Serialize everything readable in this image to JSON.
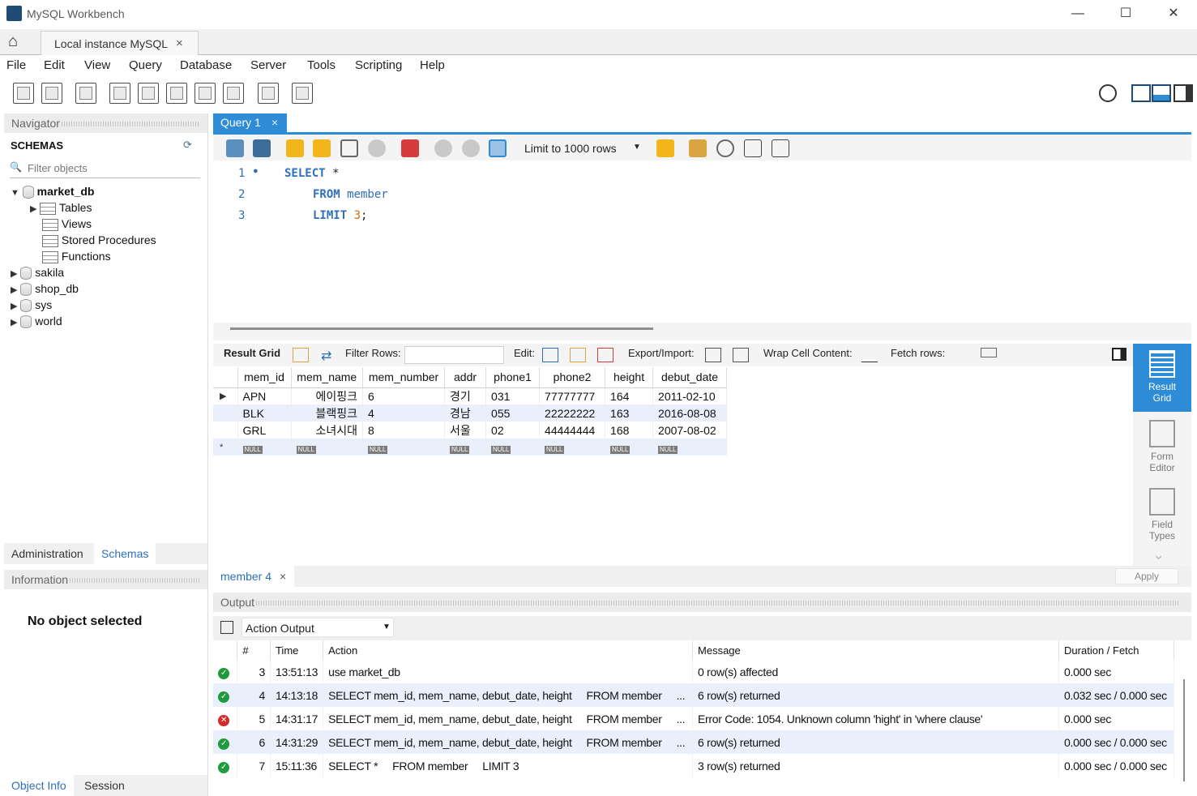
{
  "window": {
    "title": "MySQL Workbench",
    "minimize": "—",
    "maximize": "☐",
    "close": "✕"
  },
  "connection_tab": {
    "label": "Local instance MySQL",
    "close": "×"
  },
  "menu": [
    "File",
    "Edit",
    "View",
    "Query",
    "Database",
    "Server",
    "Tools",
    "Scripting",
    "Help"
  ],
  "navigator": {
    "header": "Navigator",
    "schemas_title": "SCHEMAS",
    "filter_placeholder": "Filter objects",
    "schemas": [
      {
        "name": "market_db",
        "expanded": true,
        "children": [
          "Tables",
          "Views",
          "Stored Procedures",
          "Functions"
        ]
      },
      {
        "name": "sakila"
      },
      {
        "name": "shop_db"
      },
      {
        "name": "sys"
      },
      {
        "name": "world"
      }
    ],
    "tabs": [
      "Administration",
      "Schemas"
    ],
    "active_tab": "Schemas"
  },
  "information": {
    "header": "Information",
    "message": "No object selected",
    "tabs": [
      "Object Info",
      "Session"
    ]
  },
  "query_tab": {
    "label": "Query 1",
    "close": "×"
  },
  "query_toolbar": {
    "limit_label": "Limit to 1000 rows"
  },
  "editor": {
    "lines": [
      {
        "n": "1",
        "dot": "●",
        "kw": "SELECT",
        "rest": " *"
      },
      {
        "n": "2",
        "kw": "FROM",
        "rest": " member"
      },
      {
        "n": "3",
        "kw": "LIMIT",
        "num": "3",
        "rest": ";"
      }
    ]
  },
  "result_toolbar": {
    "result_grid": "Result Grid",
    "filter_rows": "Filter Rows:",
    "edit": "Edit:",
    "export_import": "Export/Import:",
    "wrap": "Wrap Cell Content:",
    "fetch": "Fetch rows:"
  },
  "grid": {
    "columns": [
      "mem_id",
      "mem_name",
      "mem_number",
      "addr",
      "phone1",
      "phone2",
      "height",
      "debut_date"
    ],
    "rows": [
      [
        "APN",
        "에이핑크",
        "6",
        "경기",
        "031",
        "77777777",
        "164",
        "2011-02-10"
      ],
      [
        "BLK",
        "블랙핑크",
        "4",
        "경남",
        "055",
        "22222222",
        "163",
        "2016-08-08"
      ],
      [
        "GRL",
        "소녀시대",
        "8",
        "서울",
        "02",
        "44444444",
        "168",
        "2007-08-02"
      ]
    ],
    "null_label": "NULL",
    "new_row_marker": "*"
  },
  "side_tabs": [
    {
      "line1": "Result",
      "line2": "Grid",
      "active": true
    },
    {
      "line1": "Form",
      "line2": "Editor"
    },
    {
      "line1": "Field",
      "line2": "Types"
    }
  ],
  "result_tab": {
    "label": "member 4",
    "close": "×",
    "apply": "Apply"
  },
  "output": {
    "header": "Output",
    "selector": "Action Output",
    "columns": [
      "#",
      "Time",
      "Action",
      "Message",
      "Duration / Fetch"
    ],
    "rows": [
      {
        "status": "ok",
        "n": "3",
        "time": "13:51:13",
        "action": "use market_db",
        "message": "0 row(s) affected",
        "duration": "0.000 sec"
      },
      {
        "status": "ok",
        "n": "4",
        "time": "14:13:18",
        "action": "SELECT mem_id, mem_name, debut_date, height     FROM member     ...",
        "message": "6 row(s) returned",
        "duration": "0.032 sec / 0.000 sec"
      },
      {
        "status": "err",
        "n": "5",
        "time": "14:31:17",
        "action": "SELECT mem_id, mem_name, debut_date, height     FROM member     ...",
        "message": "Error Code: 1054. Unknown column 'hight' in 'where clause'",
        "duration": "0.000 sec"
      },
      {
        "status": "ok",
        "n": "6",
        "time": "14:31:29",
        "action": "SELECT mem_id, mem_name, debut_date, height     FROM member     ...",
        "message": "6 row(s) returned",
        "duration": "0.000 sec / 0.000 sec"
      },
      {
        "status": "ok",
        "n": "7",
        "time": "15:11:36",
        "action": "SELECT *     FROM member     LIMIT 3",
        "message": "3 row(s) returned",
        "duration": "0.000 sec / 0.000 sec"
      }
    ]
  }
}
